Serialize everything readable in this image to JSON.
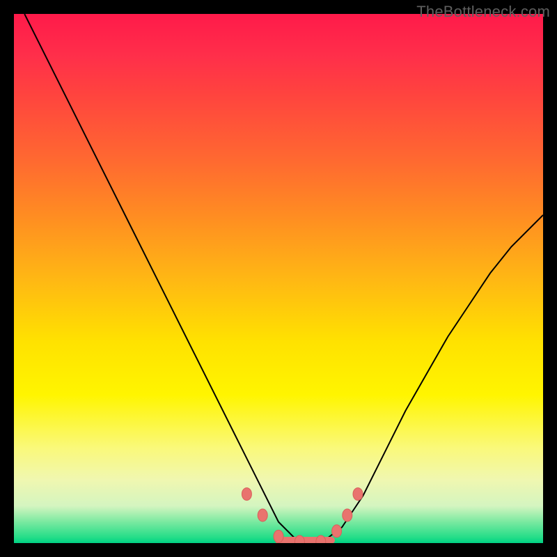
{
  "watermark": "TheBottleneck.com",
  "colors": {
    "frame": "#000000",
    "curve": "#000000",
    "marker": "#e9736e",
    "gradient_top": "#ff1a4a",
    "gradient_bottom": "#00d084"
  },
  "chart_data": {
    "type": "line",
    "title": "",
    "xlabel": "",
    "ylabel": "",
    "xlim": [
      0,
      100
    ],
    "ylim": [
      0,
      100
    ],
    "series": [
      {
        "name": "bottleneck-curve",
        "description": "V-shaped curve; y ~ bottleneck percentage (100 = worst, 0 = best). Minimum plateau near x 50-60.",
        "x": [
          2,
          6,
          10,
          14,
          18,
          22,
          26,
          30,
          34,
          38,
          42,
          46,
          50,
          54,
          58,
          62,
          66,
          70,
          74,
          78,
          82,
          86,
          90,
          94,
          98,
          100
        ],
        "y": [
          100,
          92,
          84,
          76,
          68,
          60,
          52,
          44,
          36,
          28,
          20,
          12,
          4,
          0,
          0,
          3,
          9,
          17,
          25,
          32,
          39,
          45,
          51,
          56,
          60,
          62
        ]
      }
    ],
    "markers": {
      "description": "highlighted near-zero points (pink beads) along the valley",
      "points": [
        {
          "x": 44,
          "y": 9
        },
        {
          "x": 47,
          "y": 5
        },
        {
          "x": 50,
          "y": 1
        },
        {
          "x": 54,
          "y": 0
        },
        {
          "x": 58,
          "y": 0
        },
        {
          "x": 61,
          "y": 2
        },
        {
          "x": 63,
          "y": 5
        },
        {
          "x": 65,
          "y": 9
        }
      ],
      "plateau": {
        "x_start": 50,
        "x_end": 60,
        "y": 0
      }
    }
  }
}
